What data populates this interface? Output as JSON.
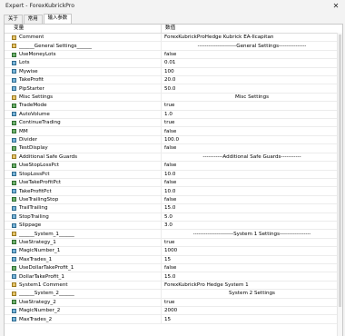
{
  "title": "Expert - ForexKubrickPro",
  "close_glyph": "✕",
  "tabs": [
    "关于",
    "常用",
    "输入参数"
  ],
  "columns": {
    "name": "变量",
    "value": "数值"
  },
  "rows": [
    {
      "name": "Comment",
      "value": "ForexKubrickProHedge Kubrick EA-Ilcapitan",
      "type": "str",
      "align": "left"
    },
    {
      "name": "______General Settings______",
      "value": "---------------------General Settings---------------",
      "type": "str",
      "align": "center"
    },
    {
      "name": "UseMoneyLots",
      "value": "false",
      "type": "bool",
      "align": "left"
    },
    {
      "name": "Lots",
      "value": "0.01",
      "type": "num",
      "align": "left"
    },
    {
      "name": "Mywise",
      "value": "100",
      "type": "num",
      "align": "left"
    },
    {
      "name": "TakeProfit",
      "value": "20.0",
      "type": "num",
      "align": "left"
    },
    {
      "name": "PipStarter",
      "value": "50.0",
      "type": "num",
      "align": "left"
    },
    {
      "name": "Misc Settings",
      "value": "Misc Settings",
      "type": "str",
      "align": "center"
    },
    {
      "name": "TradeMode",
      "value": "true",
      "type": "bool",
      "align": "left"
    },
    {
      "name": "AutoVolume",
      "value": "1.0",
      "type": "num",
      "align": "left"
    },
    {
      "name": "ContinueTrading",
      "value": "true",
      "type": "bool",
      "align": "left"
    },
    {
      "name": "MM",
      "value": "false",
      "type": "bool",
      "align": "left"
    },
    {
      "name": "Divider",
      "value": "100.0",
      "type": "num",
      "align": "left"
    },
    {
      "name": "TestDisplay",
      "value": "false",
      "type": "bool",
      "align": "left"
    },
    {
      "name": "Additional Safe Guards",
      "value": "-----------Additional Safe Guards-----------",
      "type": "str",
      "align": "center"
    },
    {
      "name": "UseStopLossPct",
      "value": "false",
      "type": "bool",
      "align": "left"
    },
    {
      "name": "StopLossPct",
      "value": "10.0",
      "type": "num",
      "align": "left"
    },
    {
      "name": "UseTakeProfitPct",
      "value": "false",
      "type": "bool",
      "align": "left"
    },
    {
      "name": "TakeProfitPct",
      "value": "10.0",
      "type": "num",
      "align": "left"
    },
    {
      "name": "UseTrailingStop",
      "value": "false",
      "type": "bool",
      "align": "left"
    },
    {
      "name": "TrailTrailing",
      "value": "15.0",
      "type": "num",
      "align": "left"
    },
    {
      "name": "StopTrailing",
      "value": "5.0",
      "type": "num",
      "align": "left"
    },
    {
      "name": "Slippage",
      "value": "3.0",
      "type": "num",
      "align": "left"
    },
    {
      "name": "______System_1______",
      "value": "----------------------System 1 Settings-----------------",
      "type": "str",
      "align": "center"
    },
    {
      "name": "UseStrategy_1",
      "value": "true",
      "type": "bool",
      "align": "left"
    },
    {
      "name": "MagicNumber_1",
      "value": "1000",
      "type": "num",
      "align": "left"
    },
    {
      "name": "MaxTrades_1",
      "value": "15",
      "type": "num",
      "align": "left"
    },
    {
      "name": "UseDollarTakeProfit_1",
      "value": "false",
      "type": "bool",
      "align": "left"
    },
    {
      "name": "DollarTakeProfit_1",
      "value": "15.0",
      "type": "num",
      "align": "left"
    },
    {
      "name": "System1 Comment",
      "value": "ForexKubrickPro Hedge System 1",
      "type": "str",
      "align": "left"
    },
    {
      "name": "______System_2______",
      "value": "System 2 Settings",
      "type": "str",
      "align": "center"
    },
    {
      "name": "UseStrategy_2",
      "value": "true",
      "type": "bool",
      "align": "left"
    },
    {
      "name": "MagicNumber_2",
      "value": "2000",
      "type": "num",
      "align": "left"
    },
    {
      "name": "MaxTrades_2",
      "value": "15",
      "type": "num",
      "align": "left"
    }
  ]
}
